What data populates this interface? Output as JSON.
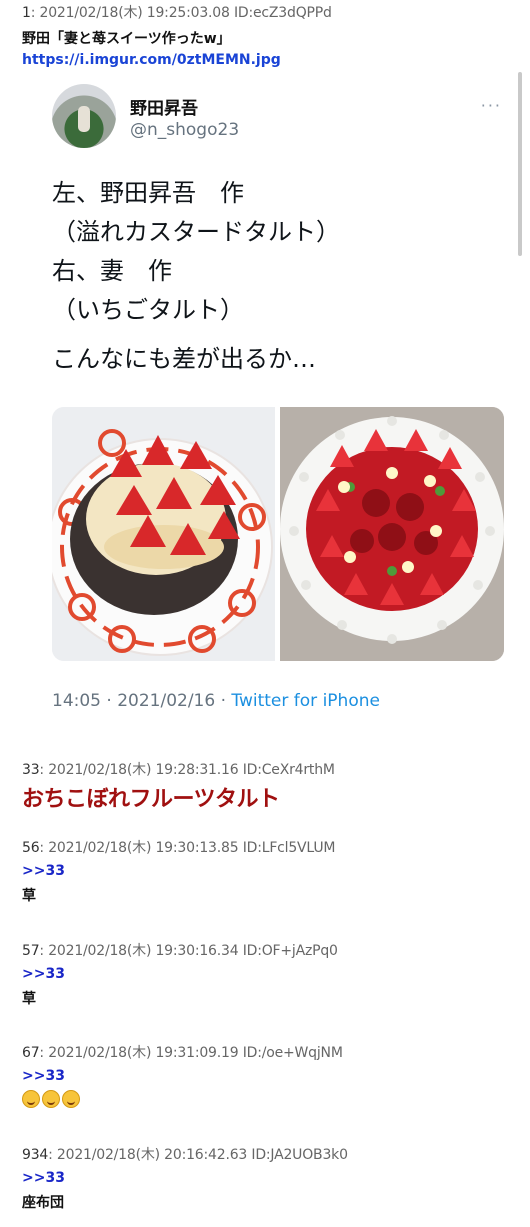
{
  "posts": [
    {
      "num": "1",
      "date": "2021/02/18(木) 19:25:03.08",
      "id": "ID:ecZ3dQPPd",
      "title": "野田「妻と苺スイーツ作ったw」",
      "link": "https://i.imgur.com/0ztMEMN.jpg"
    },
    {
      "num": "33",
      "date": "2021/02/18(木) 19:28:31.16",
      "id": "ID:CeXr4rthM",
      "body": "おちこぼれフルーツタルト"
    },
    {
      "num": "56",
      "date": "2021/02/18(木) 19:30:13.85",
      "id": "ID:LFcl5VLUM",
      "anchor": ">>33",
      "body": "草"
    },
    {
      "num": "57",
      "date": "2021/02/18(木) 19:30:16.34",
      "id": "ID:OF+jAzPq0",
      "anchor": ">>33",
      "body": "草"
    },
    {
      "num": "67",
      "date": "2021/02/18(木) 19:31:09.19",
      "id": "ID:/oe+WqjNM",
      "anchor": ">>33",
      "emojis": [
        "grinning-face",
        "savoring-face",
        "laughing-face"
      ]
    },
    {
      "num": "934",
      "date": "2021/02/18(木) 20:16:42.63",
      "id": "ID:JA2UOB3k0",
      "anchor": ">>33",
      "body": "座布団"
    }
  ],
  "tweet": {
    "name": "野田昇吾",
    "handle": "@n_shogo23",
    "more": "···",
    "lines": [
      "左、野田昇吾　作",
      "（溢れカスタードタルト）",
      "右、妻　作",
      "（いちごタルト）",
      "こんなにも差が出るか…"
    ],
    "time": "14:05 · 2021/02/16 · ",
    "source": "Twitter for iPhone",
    "photo_left": "custard-tart-photo",
    "photo_right": "strawberry-tart-photo"
  },
  "colors": {
    "link": "#1a44d6",
    "anchor": "#1a27c8",
    "highlight": "#a01010",
    "twitter_blue": "#1b8fe0"
  }
}
